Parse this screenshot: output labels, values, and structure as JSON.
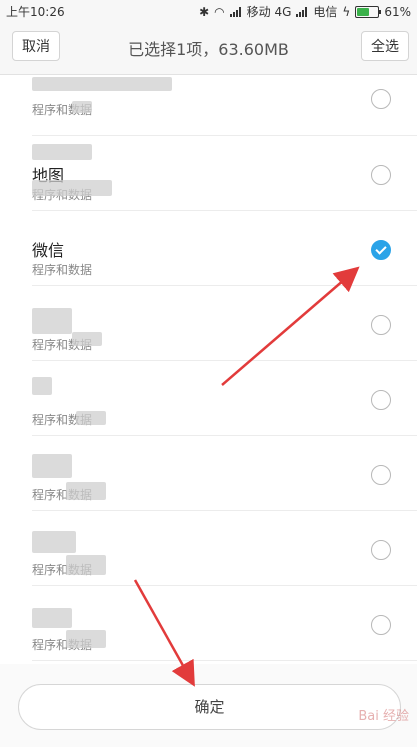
{
  "status_bar": {
    "time": "上午10:26",
    "carrier1": "移动 4G",
    "carrier2": "电信",
    "battery": "61%",
    "battery_level": 0.61
  },
  "header": {
    "cancel_label": "取消",
    "title": "已选择1项，63.60MB",
    "select_all_label": "全选"
  },
  "items": [
    {
      "name": "",
      "subtitle": "程序和数据",
      "checked": false,
      "blurred": true
    },
    {
      "name": "地图",
      "subtitle": "程序和数据",
      "checked": false,
      "blurred": true
    },
    {
      "name": "微信",
      "subtitle": "程序和数据",
      "checked": true,
      "blurred": false
    },
    {
      "name": "",
      "subtitle": "程序和数据",
      "checked": false,
      "blurred": true
    },
    {
      "name": "",
      "subtitle": "程序和数据",
      "checked": false,
      "blurred": true
    },
    {
      "name": "",
      "subtitle": "程序和数据",
      "checked": false,
      "blurred": true
    },
    {
      "name": "",
      "subtitle": "程序和数据",
      "checked": false,
      "blurred": true
    },
    {
      "name": "",
      "subtitle": "程序和数据",
      "checked": false,
      "blurred": true
    }
  ],
  "footer": {
    "confirm_label": "确定"
  },
  "watermark": "Bai 经验",
  "colors": {
    "accent": "#2aa3e8",
    "arrow": "#e23b3b"
  }
}
